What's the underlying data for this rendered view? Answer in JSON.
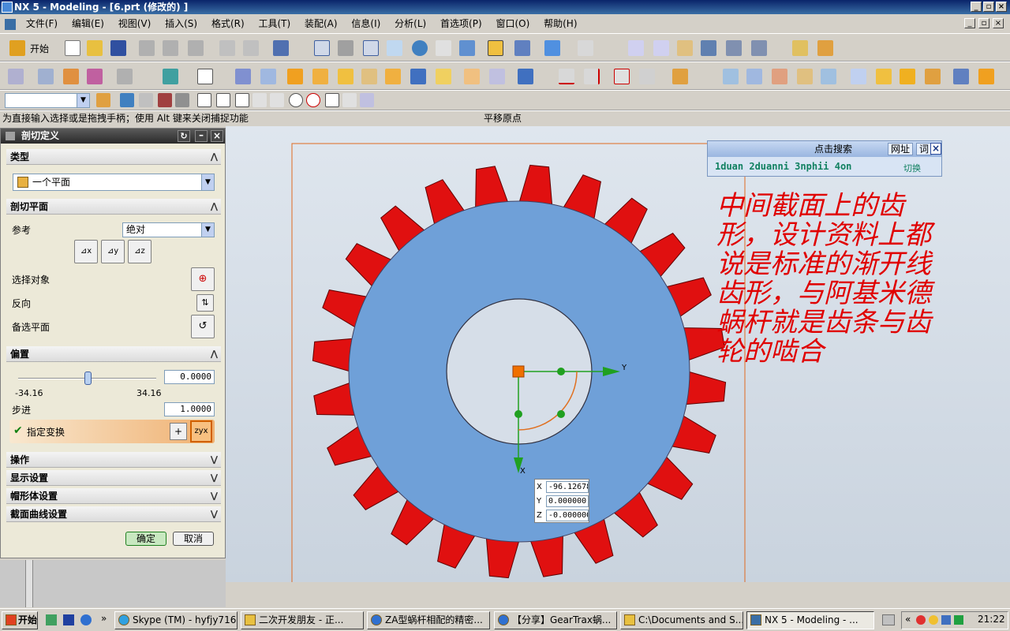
{
  "window": {
    "title": "NX 5 - Modeling - [6.prt (修改的) ]"
  },
  "menu": [
    "文件(F)",
    "编辑(E)",
    "视图(V)",
    "插入(S)",
    "格式(R)",
    "工具(T)",
    "装配(A)",
    "信息(I)",
    "分析(L)",
    "首选项(P)",
    "窗口(O)",
    "帮助(H)"
  ],
  "toolbar": {
    "start_label": "开始"
  },
  "prompt": {
    "left": "为直接输入选择或是拖拽手柄；使用 Alt 键来关闭捕捉功能",
    "right": "平移原点"
  },
  "dialog": {
    "title": "剖切定义",
    "type_section": "类型",
    "type_value": "一个平面",
    "plane_section": "剖切平面",
    "reference_label": "参考",
    "reference_value": "绝对",
    "select_object_label": "选择对象",
    "reverse_label": "反向",
    "alt_plane_label": "备选平面",
    "offset_section": "偏置",
    "offset_value": "0.0000",
    "slider_min": "-34.16",
    "slider_max": "34.16",
    "slider_fraction": 0.5,
    "step_label": "步进",
    "step_value": "1.0000",
    "specify_transform_label": "指定变换",
    "operation_section": "操作",
    "display_section": "显示设置",
    "cap_section": "帽形体设置",
    "curve_section": "截面曲线设置",
    "ok_label": "确定",
    "cancel_label": "取消"
  },
  "search": {
    "title": "点击搜索",
    "url_btn": "网址",
    "word_btn": "词",
    "text": "1duan 2duanni 3nphii 4on",
    "switch": "切换"
  },
  "annotation": "中间截面上的齿形，设计资料上都说是标准的渐开线齿形，与阿基米德蜗杆就是齿条与齿轮的啮合",
  "viewport": {
    "axis_y": "Y",
    "axis_x": "X"
  },
  "coords": {
    "x_label": "X",
    "x": "-96.12678",
    "y_label": "Y",
    "y": "0.000000",
    "z_label": "Z",
    "z": "-0.000000"
  },
  "taskbar": {
    "start": "开始",
    "tasks": [
      "Skype (TM) - hyfjy716",
      "二次开发朋友 - 正...",
      "ZA型蜗杆相配的精密...",
      "【分享】GearTrax蜗...",
      "C:\\Documents and S...",
      "NX 5 - Modeling - ..."
    ],
    "time": "21:22"
  },
  "colors": {
    "gear_face": "#6fa0d8",
    "gear_teeth": "#e01010",
    "annotation": "#e00000",
    "title_bar": "#0a246a"
  }
}
